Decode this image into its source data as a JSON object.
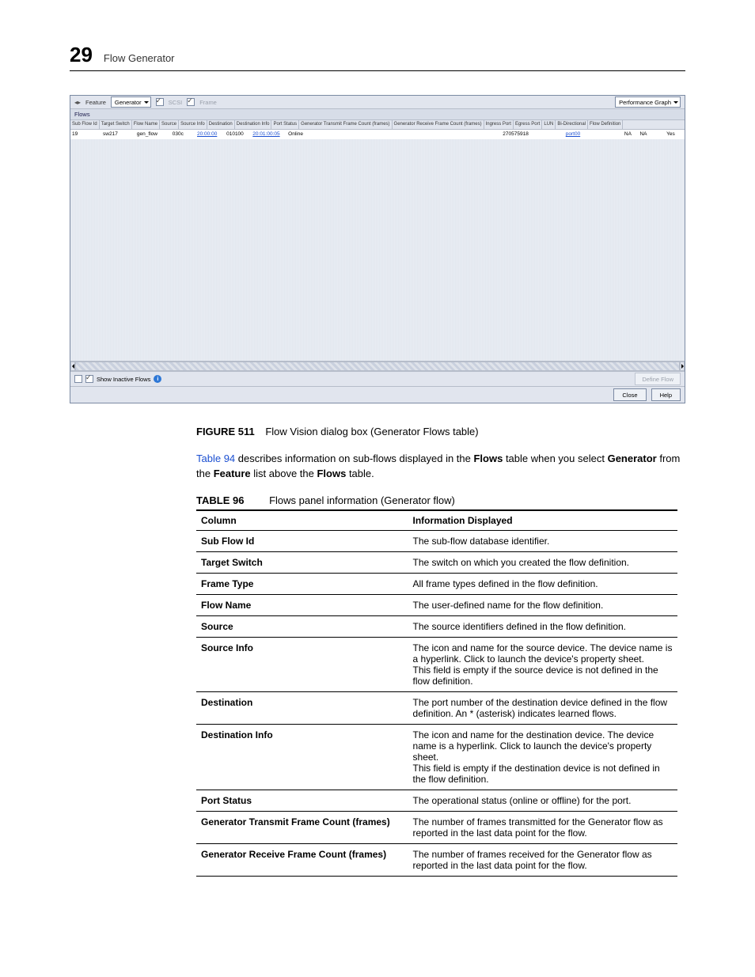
{
  "header": {
    "chapter_number": "29",
    "chapter_title": "Flow Generator"
  },
  "dialog": {
    "feature_label": "Feature",
    "feature_value": "Generator",
    "scsi_label": "SCSI",
    "frame_label": "Frame",
    "perf_button": "Performance Graph",
    "flows_title": "Flows",
    "columns": [
      "Sub Flow Id",
      "Target Switch",
      "Flow Name",
      "Source",
      "Source Info",
      "Destination",
      "Destination Info",
      "Port Status",
      "Generator Transmit Frame Count (frames)",
      "Generator Receive Frame Count (frames)",
      "Ingress Port",
      "Egress Port",
      "LUN",
      "Bi-Directional",
      "Flow Definition"
    ],
    "row": {
      "sub_flow_id": "19",
      "target_switch": "sw217",
      "flow_name": "gen_flow",
      "source": "030c",
      "source_link": "20:00:00",
      "destination": "010100",
      "destination_link": "20:01:00:05",
      "port_status": "Online",
      "tx": "",
      "rx": "270575918",
      "ingress": "",
      "egress_link": "port00",
      "lun": "NA",
      "bidir": "NA",
      "flow_def": "Yes"
    },
    "show_inactive": "Show Inactive Flows",
    "define_flow": "Define Flow",
    "close": "Close",
    "help": "Help"
  },
  "figure": {
    "label": "FIGURE 511",
    "caption": "Flow Vision dialog box (Generator Flows table)"
  },
  "para": {
    "link": "Table 94",
    "before": " describes information on sub-flows displayed in the ",
    "bold1": "Flows",
    "mid": " table when you select ",
    "bold2": "Generator",
    "mid2": " from the ",
    "bold3": "Feature",
    "mid3": " list above the ",
    "bold4": "Flows",
    "end": " table."
  },
  "table": {
    "label": "TABLE 96",
    "title": "Flows panel information (Generator flow)",
    "head_col": "Column",
    "head_info": "Information Displayed",
    "rows": [
      {
        "c": "Sub Flow Id",
        "d": "The sub-flow database identifier."
      },
      {
        "c": "Target Switch",
        "d": "The switch on which you created the flow definition."
      },
      {
        "c": "Frame Type",
        "d": "All frame types defined in the flow definition."
      },
      {
        "c": "Flow Name",
        "d": "The user-defined name for the flow definition."
      },
      {
        "c": "Source",
        "d": "The source identifiers defined in the flow definition."
      },
      {
        "c": "Source Info",
        "d": "The icon and name for the source device. The device name is a hyperlink. Click to launch the device's property sheet.\nThis field is empty if the source device is not defined in the flow definition."
      },
      {
        "c": "Destination",
        "d": "The port number of the destination device defined in the flow definition. An * (asterisk) indicates learned flows."
      },
      {
        "c": "Destination Info",
        "d": "The icon and name for the destination device. The device name is a hyperlink. Click to launch the device's property sheet.\nThis field is empty if the destination device is not defined in the flow definition."
      },
      {
        "c": "Port Status",
        "d": "The operational status (online or offline) for the port."
      },
      {
        "c": "Generator Transmit Frame Count (frames)",
        "d": "The number of frames transmitted for the Generator flow as reported in the last data point for the flow."
      },
      {
        "c": "Generator Receive Frame Count (frames)",
        "d": "The number of frames received for the Generator flow as reported in the last data point for the flow."
      }
    ]
  }
}
